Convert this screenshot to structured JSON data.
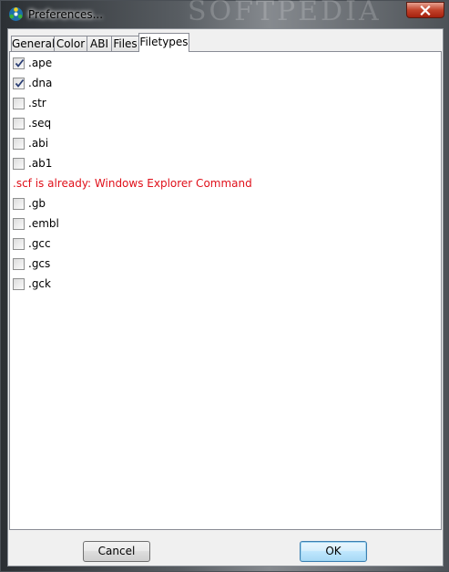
{
  "window": {
    "title": "Preferences...",
    "watermark": "SOFTPEDIA"
  },
  "tabs": [
    {
      "label": "General"
    },
    {
      "label": "Color"
    },
    {
      "label": "ABI"
    },
    {
      "label": "Files"
    },
    {
      "label": "Filetypes",
      "active": true
    }
  ],
  "filetypes": {
    "items_top": [
      {
        "label": ".ape",
        "checked": true
      },
      {
        "label": ".dna",
        "checked": true
      },
      {
        "label": ".str",
        "checked": false
      },
      {
        "label": ".seq",
        "checked": false
      },
      {
        "label": ".abi",
        "checked": false
      },
      {
        "label": ".ab1",
        "checked": false
      }
    ],
    "warning": ".scf is already: Windows Explorer Command",
    "warning_color": "#e0101a",
    "items_bottom": [
      {
        "label": ".gb",
        "checked": false
      },
      {
        "label": ".embl",
        "checked": false
      },
      {
        "label": ".gcc",
        "checked": false
      },
      {
        "label": ".gcs",
        "checked": false
      },
      {
        "label": ".gck",
        "checked": false
      }
    ]
  },
  "buttons": {
    "cancel_label": "Cancel",
    "ok_label": "OK"
  },
  "colors": {
    "close_button": "#c2432b",
    "ok_accent": "#3c7fb1"
  }
}
